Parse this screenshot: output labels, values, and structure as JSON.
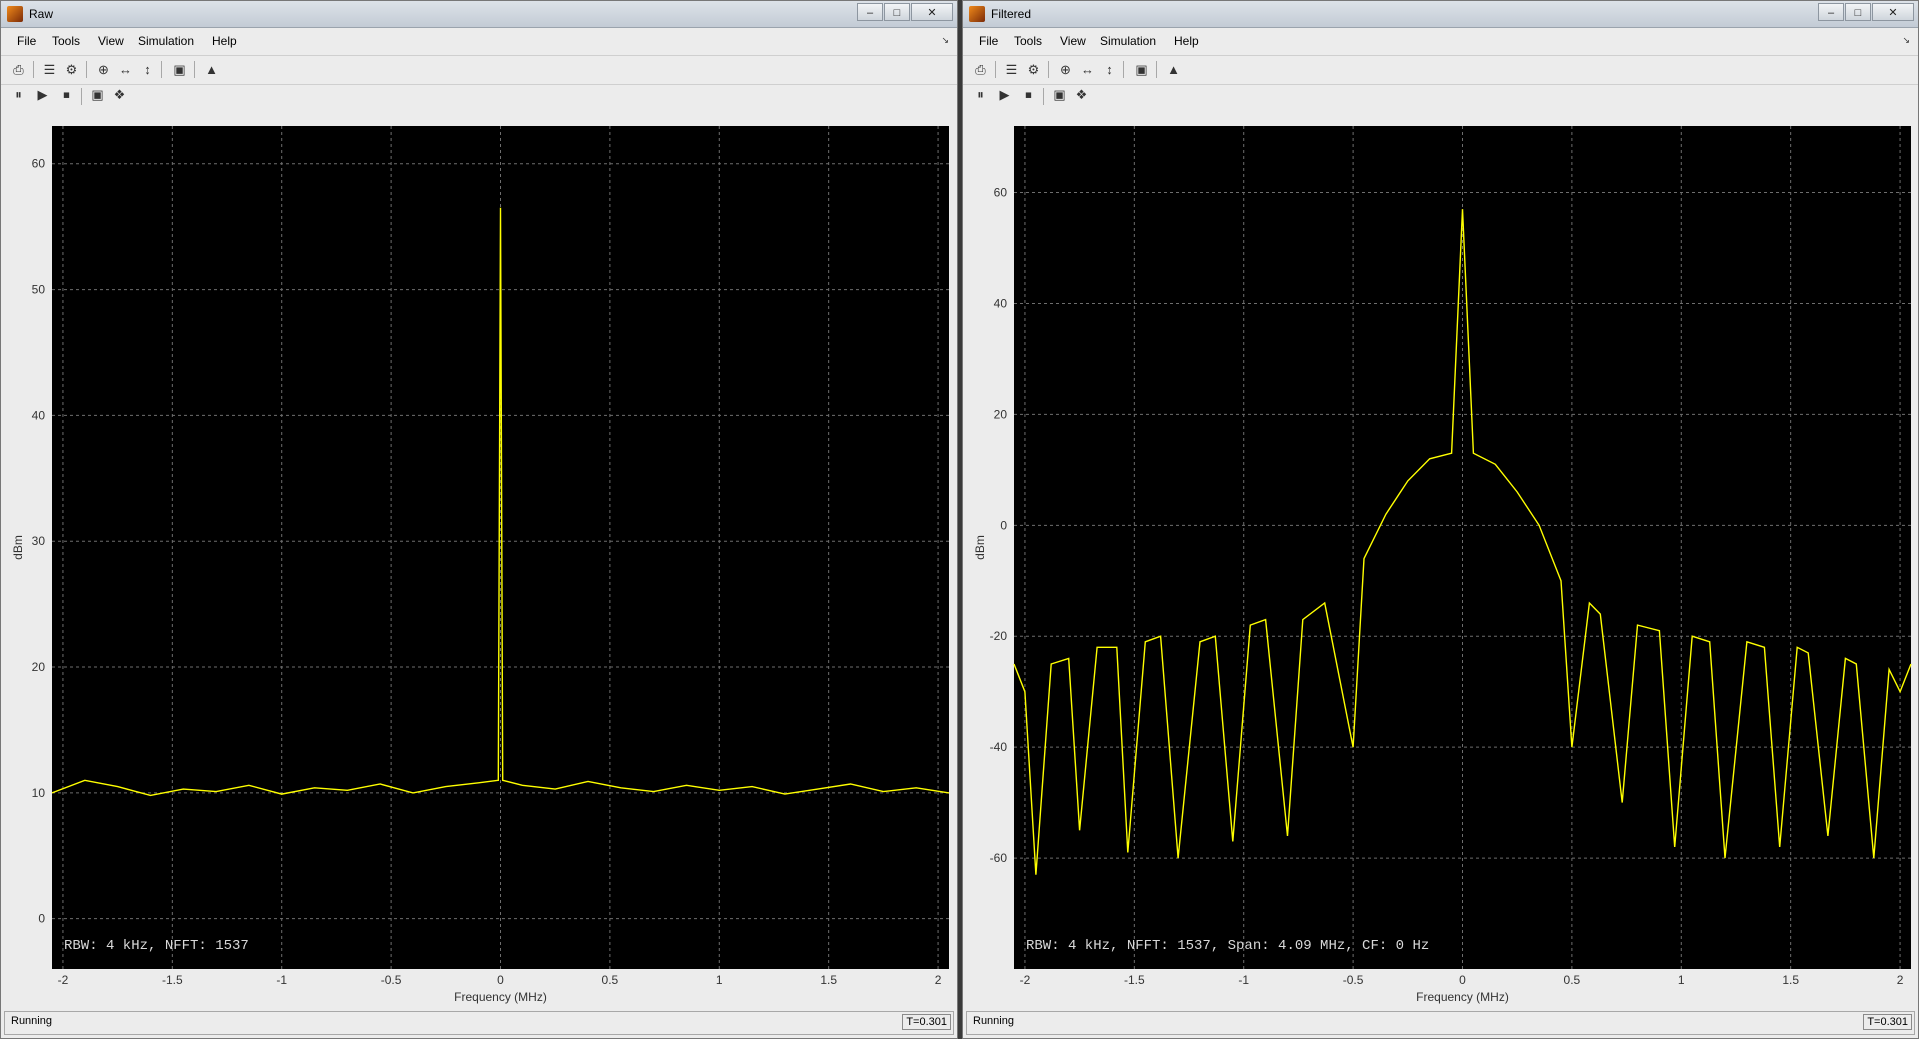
{
  "windows": [
    {
      "title": "Raw",
      "menu": [
        "File",
        "Tools",
        "View",
        "Simulation",
        "Help"
      ],
      "status": "Running",
      "time": "T=0.301",
      "chart_data": {
        "type": "line",
        "xlabel": "Frequency (MHz)",
        "ylabel": "dBm",
        "annotation": "RBW: 4 kHz, NFFT: 1537",
        "xlim": [
          -2.05,
          2.05
        ],
        "ylim": [
          -4,
          63
        ],
        "xticks": [
          -2,
          -1.5,
          -1,
          -0.5,
          0,
          0.5,
          1,
          1.5,
          2
        ],
        "yticks": [
          0,
          10,
          20,
          30,
          40,
          50,
          60
        ],
        "grid": true,
        "line_color": "#ffff00",
        "series": [
          {
            "x": [
              -2.05,
              -1.9,
              -1.75,
              -1.6,
              -1.45,
              -1.3,
              -1.15,
              -1.0,
              -0.85,
              -0.7,
              -0.55,
              -0.4,
              -0.25,
              -0.1,
              -0.01,
              0,
              0.01,
              0.1,
              0.25,
              0.4,
              0.55,
              0.7,
              0.85,
              1.0,
              1.15,
              1.3,
              1.45,
              1.6,
              1.75,
              1.9,
              2.05
            ],
            "y": [
              10,
              11,
              10.5,
              9.8,
              10.3,
              10.1,
              10.6,
              9.9,
              10.4,
              10.2,
              10.7,
              10.0,
              10.5,
              10.8,
              11,
              56.5,
              11,
              10.6,
              10.3,
              10.9,
              10.4,
              10.1,
              10.6,
              10.2,
              10.5,
              9.9,
              10.3,
              10.7,
              10.1,
              10.4,
              10
            ]
          }
        ]
      }
    },
    {
      "title": "Filtered",
      "menu": [
        "File",
        "Tools",
        "View",
        "Simulation",
        "Help"
      ],
      "status": "Running",
      "time": "T=0.301",
      "chart_data": {
        "type": "line",
        "xlabel": "Frequency (MHz)",
        "ylabel": "dBm",
        "annotation": "RBW: 4 kHz, NFFT: 1537, Span: 4.09 MHz, CF: 0 Hz",
        "xlim": [
          -2.05,
          2.05
        ],
        "ylim": [
          -80,
          72
        ],
        "xticks": [
          -2,
          -1.5,
          -1,
          -0.5,
          0,
          0.5,
          1,
          1.5,
          2
        ],
        "yticks": [
          -60,
          -40,
          -20,
          0,
          20,
          40,
          60
        ],
        "grid": true,
        "line_color": "#ffff00",
        "series": [
          {
            "x": [
              -2.05,
              -2.0,
              -1.95,
              -1.88,
              -1.8,
              -1.75,
              -1.67,
              -1.58,
              -1.53,
              -1.45,
              -1.38,
              -1.3,
              -1.2,
              -1.13,
              -1.05,
              -0.97,
              -0.9,
              -0.8,
              -0.73,
              -0.63,
              -0.5,
              -0.45,
              -0.35,
              -0.25,
              -0.15,
              -0.05,
              0,
              0.05,
              0.15,
              0.25,
              0.35,
              0.45,
              0.5,
              0.58,
              0.63,
              0.73,
              0.8,
              0.9,
              0.97,
              1.05,
              1.13,
              1.2,
              1.3,
              1.38,
              1.45,
              1.53,
              1.58,
              1.67,
              1.75,
              1.8,
              1.88,
              1.95,
              2.0,
              2.05
            ],
            "y": [
              -25,
              -30,
              -63,
              -25,
              -24,
              -55,
              -22,
              -22,
              -59,
              -21,
              -20,
              -60,
              -21,
              -20,
              -57,
              -18,
              -17,
              -56,
              -17,
              -14,
              -40,
              -6,
              2,
              8,
              12,
              13,
              57,
              13,
              11,
              6,
              0,
              -10,
              -40,
              -14,
              -16,
              -50,
              -18,
              -19,
              -58,
              -20,
              -21,
              -60,
              -21,
              -22,
              -58,
              -22,
              -23,
              -56,
              -24,
              -25,
              -60,
              -26,
              -30,
              -25
            ]
          }
        ]
      }
    }
  ]
}
